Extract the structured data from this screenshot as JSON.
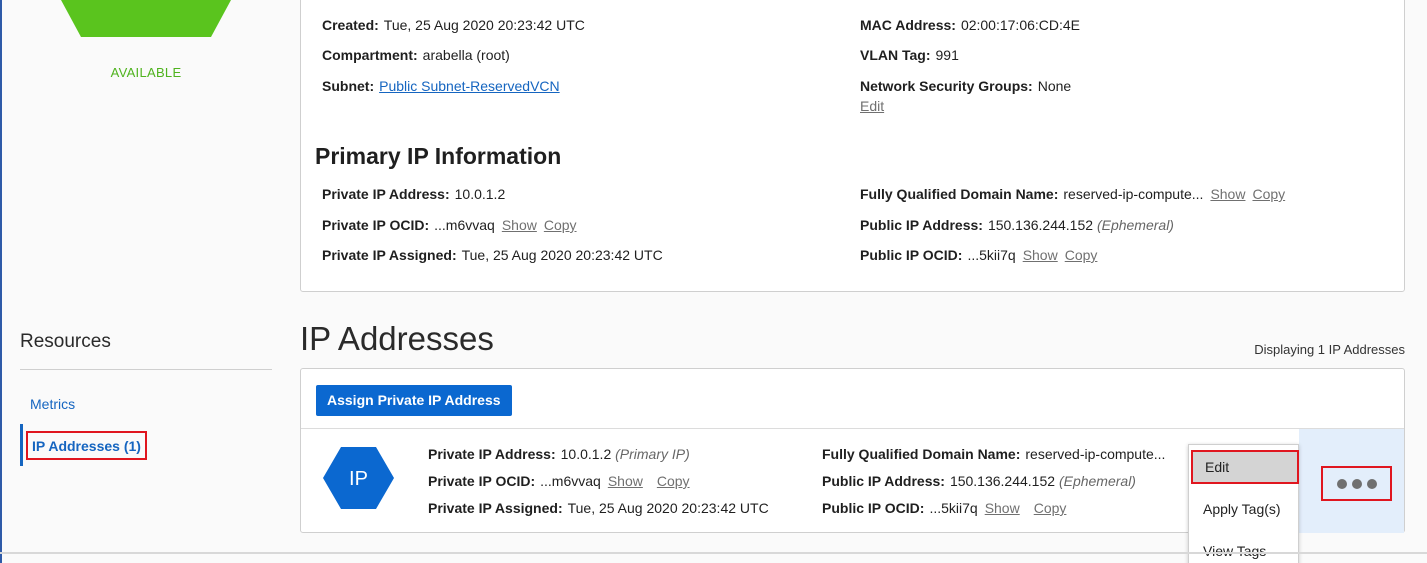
{
  "instance": {
    "status": "AVAILABLE",
    "colors": {
      "status_green": "#5fc51f",
      "hex_green": "#5ac41e"
    }
  },
  "vnic": {
    "created_label": "Created:",
    "created_value": "Tue, 25 Aug 2020 20:23:42 UTC",
    "compartment_label": "Compartment:",
    "compartment_value": "arabella (root)",
    "subnet_label": "Subnet:",
    "subnet_value": "Public Subnet-ReservedVCN",
    "mac_label": "MAC Address:",
    "mac_value": "02:00:17:06:CD:4E",
    "vlan_label": "VLAN Tag:",
    "vlan_value": "991",
    "nsg_label": "Network Security Groups:",
    "nsg_value": "None",
    "nsg_edit": "Edit"
  },
  "primary_ip": {
    "section_title": "Primary IP Information",
    "private_ip_label": "Private IP Address:",
    "private_ip_value": "10.0.1.2",
    "ocid_label": "Private IP OCID:",
    "ocid_value": "...m6vvaq",
    "assigned_label": "Private IP Assigned:",
    "assigned_value": "Tue, 25 Aug 2020 20:23:42 UTC",
    "fqdn_label": "Fully Qualified Domain Name:",
    "fqdn_value": "reserved-ip-compute...",
    "public_ip_label": "Public IP Address:",
    "public_ip_value": "150.136.244.152",
    "public_ip_type": "(Ephemeral)",
    "public_ocid_label": "Public IP OCID:",
    "public_ocid_value": "...5kii7q",
    "show": "Show",
    "copy": "Copy"
  },
  "resources": {
    "title": "Resources",
    "items": [
      {
        "label": "Metrics"
      },
      {
        "label": "IP Addresses (1)"
      }
    ]
  },
  "ip_list": {
    "title": "IP Addresses",
    "count_text": "Displaying 1 IP Addresses",
    "assign_button": "Assign Private IP Address",
    "row": {
      "icon_text": "IP",
      "private_ip_label": "Private IP Address:",
      "private_ip_value": "10.0.1.2",
      "private_ip_note": "(Primary IP)",
      "ocid_label": "Private IP OCID:",
      "ocid_value": "...m6vvaq",
      "assigned_label": "Private IP Assigned:",
      "assigned_value": "Tue, 25 Aug 2020 20:23:42 UTC",
      "fqdn_label": "Fully Qualified Domain Name:",
      "fqdn_value": "reserved-ip-compute...",
      "public_ip_label": "Public IP Address:",
      "public_ip_value": "150.136.244.152",
      "public_ip_type": "(Ephemeral)",
      "public_ocid_label": "Public IP OCID:",
      "public_ocid_value": "...5kii7q",
      "show": "Show",
      "copy": "Copy"
    },
    "menu": [
      {
        "label": "Edit"
      },
      {
        "label": "Apply Tag(s)"
      },
      {
        "label": "View Tags"
      }
    ]
  },
  "colors": {
    "link_blue": "#1565c0",
    "primary_button": "#0b68d0",
    "highlight_red": "#e0161f",
    "ip_hex_blue": "#0b68d0"
  }
}
